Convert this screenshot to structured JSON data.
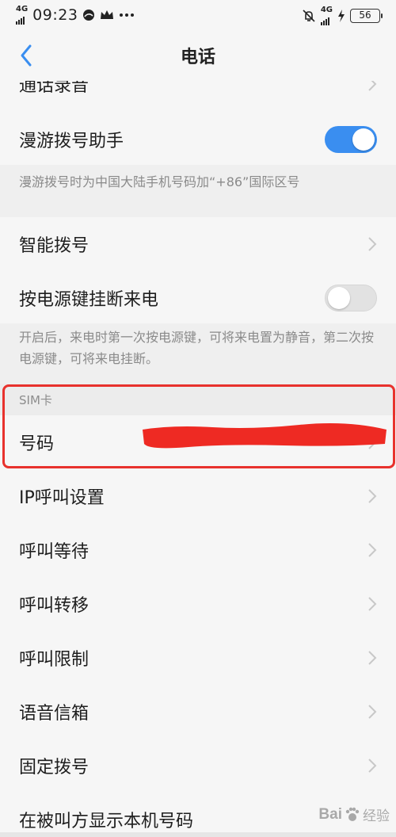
{
  "colors": {
    "accent": "#3a8ef0",
    "background": "#f6f6f6",
    "highlight": "#e8322d",
    "redaction": "#ee2a23"
  },
  "status_bar": {
    "network_left": "4G",
    "time": "09:23",
    "icons_left": [
      "camera-app-icon",
      "crown-icon",
      "more-dots-icon"
    ],
    "icons_right": [
      "mute-icon",
      "lte-signal-icon",
      "charging-icon"
    ],
    "network_right": "4G",
    "battery": "56"
  },
  "nav": {
    "title": "电话",
    "back_icon": "chevron-left-icon"
  },
  "rows": {
    "call_recording": {
      "label": "通话录音"
    },
    "roaming_assistant": {
      "label": "漫游拨号助手",
      "toggle": true,
      "note": "漫游拨号时为中国大陆手机号码加“+86”国际区号"
    },
    "smart_dial": {
      "label": "智能拨号"
    },
    "power_key": {
      "label": "按电源键挂断来电",
      "toggle": false,
      "note": "开启后，来电时第一次按电源键，可将来电置为静音，第二次按电源键，可将来电挂断。"
    },
    "sim_section": {
      "header": "SIM卡"
    },
    "number": {
      "label": "号码"
    },
    "ip_call": {
      "label": "IP呼叫设置"
    },
    "call_waiting": {
      "label": "呼叫等待"
    },
    "call_forward": {
      "label": "呼叫转移"
    },
    "call_barring": {
      "label": "呼叫限制"
    },
    "voicemail": {
      "label": "语音信箱"
    },
    "fixed_dial": {
      "label": "固定拨号"
    },
    "show_number": {
      "label": "在被叫方显示本机号码"
    }
  },
  "watermark": {
    "brand": "Bai",
    "brand_tail": "经验"
  }
}
